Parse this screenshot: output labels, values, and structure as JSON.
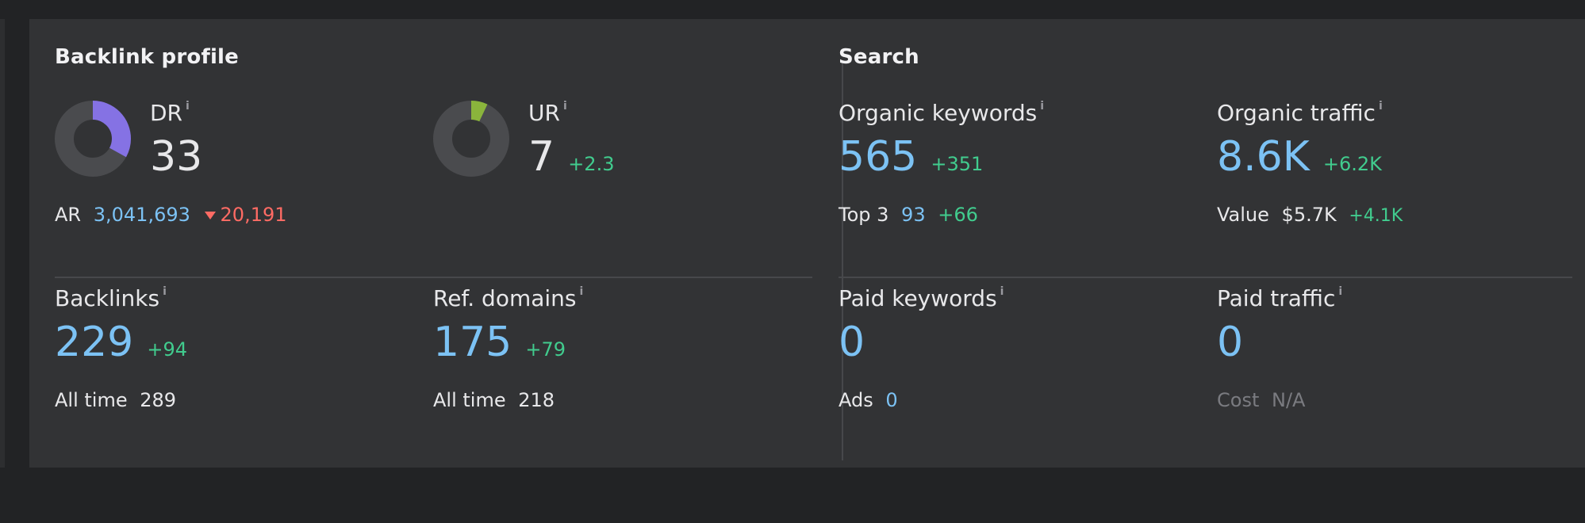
{
  "backlink_profile": {
    "title": "Backlink profile",
    "info_glyph": "i",
    "dr": {
      "label": "DR",
      "value": "33",
      "donut_fraction": 0.33,
      "color": "#8572e4"
    },
    "ur": {
      "label": "UR",
      "value": "7",
      "delta": "+2.3",
      "donut_fraction": 0.07,
      "color": "#8ab43c"
    },
    "ar": {
      "label": "AR",
      "value": "3,041,693",
      "delta": "20,191"
    },
    "backlinks": {
      "label": "Backlinks",
      "value": "229",
      "delta": "+94",
      "all_time_label": "All time",
      "all_time_value": "289"
    },
    "ref_domains": {
      "label": "Ref. domains",
      "value": "175",
      "delta": "+79",
      "all_time_label": "All time",
      "all_time_value": "218"
    }
  },
  "search": {
    "title": "Search",
    "organic_keywords": {
      "label": "Organic keywords",
      "value": "565",
      "delta": "+351",
      "sub_label": "Top 3",
      "sub_value": "93",
      "sub_delta": "+66"
    },
    "organic_traffic": {
      "label": "Organic traffic",
      "value": "8.6K",
      "delta": "+6.2K",
      "sub_label": "Value",
      "sub_value": "$5.7K",
      "sub_delta": "+4.1K"
    },
    "paid_keywords": {
      "label": "Paid keywords",
      "value": "0",
      "sub_label": "Ads",
      "sub_value": "0"
    },
    "paid_traffic": {
      "label": "Paid traffic",
      "value": "0",
      "sub_label": "Cost",
      "sub_value": "N/A"
    }
  },
  "colors": {
    "accent_blue": "#7cc2f4",
    "positive": "#41cc8e",
    "negative": "#ff6b64",
    "donut_track": "#4a4b4e"
  }
}
